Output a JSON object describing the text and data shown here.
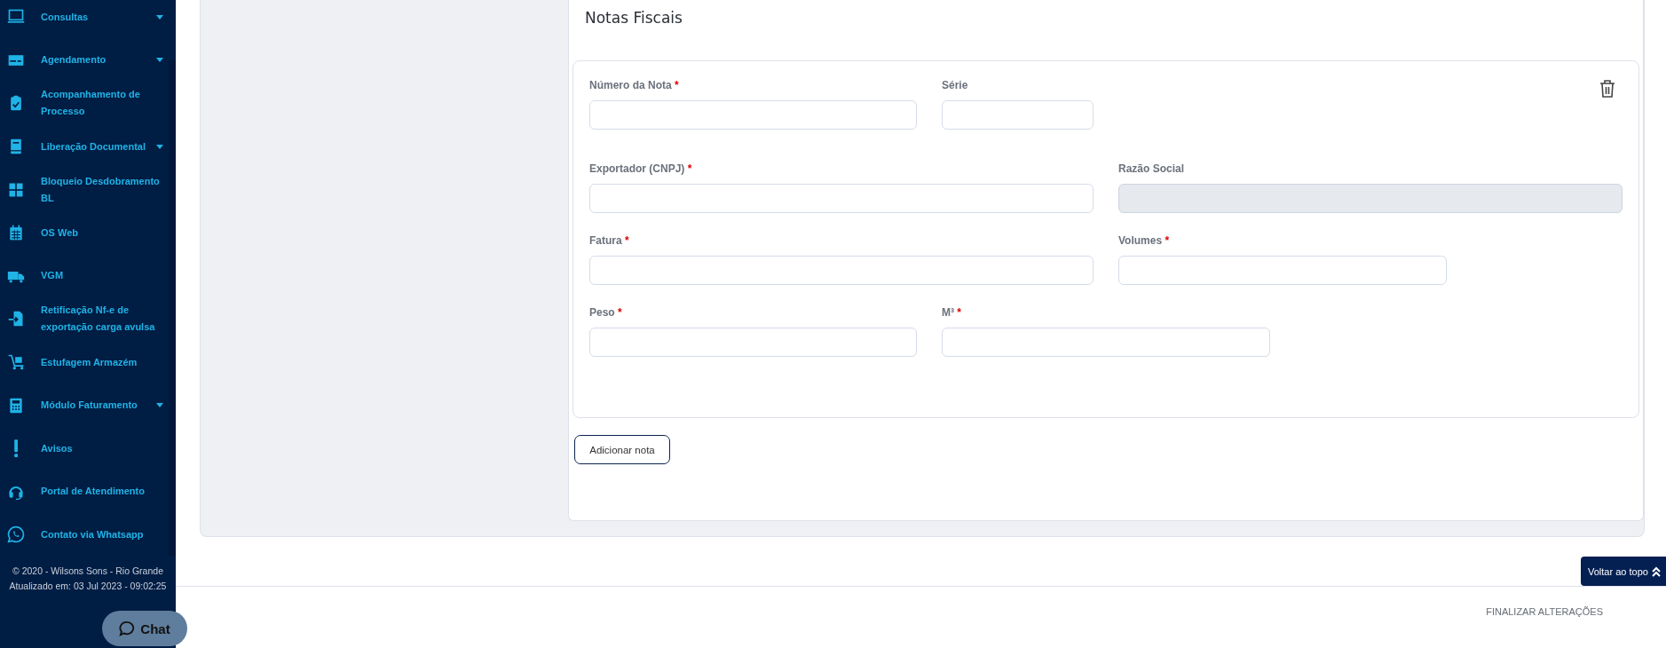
{
  "sidebar": {
    "items": [
      {
        "label": "Consultas",
        "expandable": true
      },
      {
        "label": "Agendamento",
        "expandable": true
      },
      {
        "label": "Acompanhamento de Processo",
        "expandable": false
      },
      {
        "label": "Liberação Documental",
        "expandable": true
      },
      {
        "label": "Bloqueio Desdobramento BL",
        "expandable": false
      },
      {
        "label": "OS Web",
        "expandable": false
      },
      {
        "label": "VGM",
        "expandable": false
      },
      {
        "label": "Retificação Nf-e de exportação carga avulsa",
        "expandable": false
      },
      {
        "label": "Estufagem Armazém",
        "expandable": false
      },
      {
        "label": "Módulo Faturamento",
        "expandable": true
      },
      {
        "label": "Avisos",
        "expandable": false
      },
      {
        "label": "Portal de Atendimento",
        "expandable": false
      },
      {
        "label": "Contato via Whatsapp",
        "expandable": false
      }
    ],
    "copyright": "© 2020 - Wilsons Sons - Rio Grande",
    "updated": "Atualizado em: 03 Jul 2023 - 09:02:25"
  },
  "section": {
    "title": "Notas Fiscais",
    "rows": [
      [
        {
          "label": "Número da Nota",
          "required": true,
          "disabled": false
        },
        {
          "label": "Série",
          "required": false,
          "disabled": false
        }
      ],
      [
        {
          "label": "Exportador (CNPJ)",
          "required": true,
          "disabled": false
        },
        {
          "label": "Razão Social",
          "required": false,
          "disabled": true
        }
      ],
      [
        {
          "label": "Fatura",
          "required": true,
          "disabled": false
        },
        {
          "label": "Volumes",
          "required": true,
          "disabled": false
        }
      ],
      [
        {
          "label": "Peso",
          "required": true,
          "disabled": false
        },
        {
          "label": "M³",
          "required": true,
          "disabled": false
        }
      ]
    ],
    "add_button": "Adicionar nota"
  },
  "back_to_top": "Voltar ao topo",
  "finalize": "FINALIZAR ALTERAÇÕES",
  "chat": "Chat",
  "required_mark": "*"
}
